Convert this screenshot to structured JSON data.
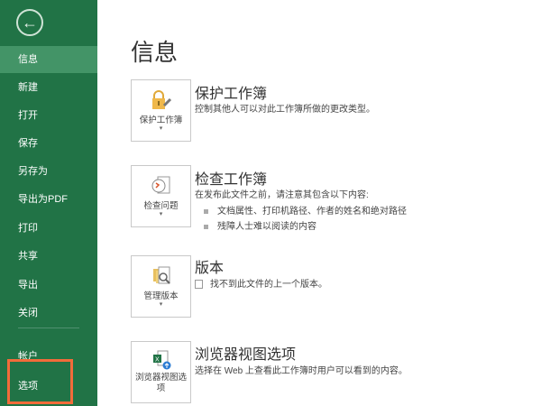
{
  "sidebar": {
    "items": [
      {
        "label": "信息"
      },
      {
        "label": "新建"
      },
      {
        "label": "打开"
      },
      {
        "label": "保存"
      },
      {
        "label": "另存为"
      },
      {
        "label": "导出为PDF"
      },
      {
        "label": "打印"
      },
      {
        "label": "共享"
      },
      {
        "label": "导出"
      },
      {
        "label": "关闭"
      },
      {
        "label": "帐户"
      },
      {
        "label": "选项"
      }
    ]
  },
  "main": {
    "title": "信息",
    "sections": [
      {
        "button": "保护工作簿",
        "title": "保护工作簿",
        "desc": "控制其他人可以对此工作簿所做的更改类型。"
      },
      {
        "button": "检查问题",
        "title": "检查工作簿",
        "desc": "在发布此文件之前，请注意其包含以下内容:",
        "bullets": [
          "文档属性、打印机路径、作者的姓名和绝对路径",
          "残障人士难以阅读的内容"
        ]
      },
      {
        "button": "管理版本",
        "title": "版本",
        "desc": "找不到此文件的上一个版本。"
      },
      {
        "button": "浏览器视图选项",
        "title": "浏览器视图选项",
        "desc": "选择在 Web 上查看此工作簿时用户可以看到的内容。"
      }
    ]
  },
  "colors": {
    "sidebar": "#217346",
    "active": "#439467",
    "highlight": "#f26b3a"
  }
}
